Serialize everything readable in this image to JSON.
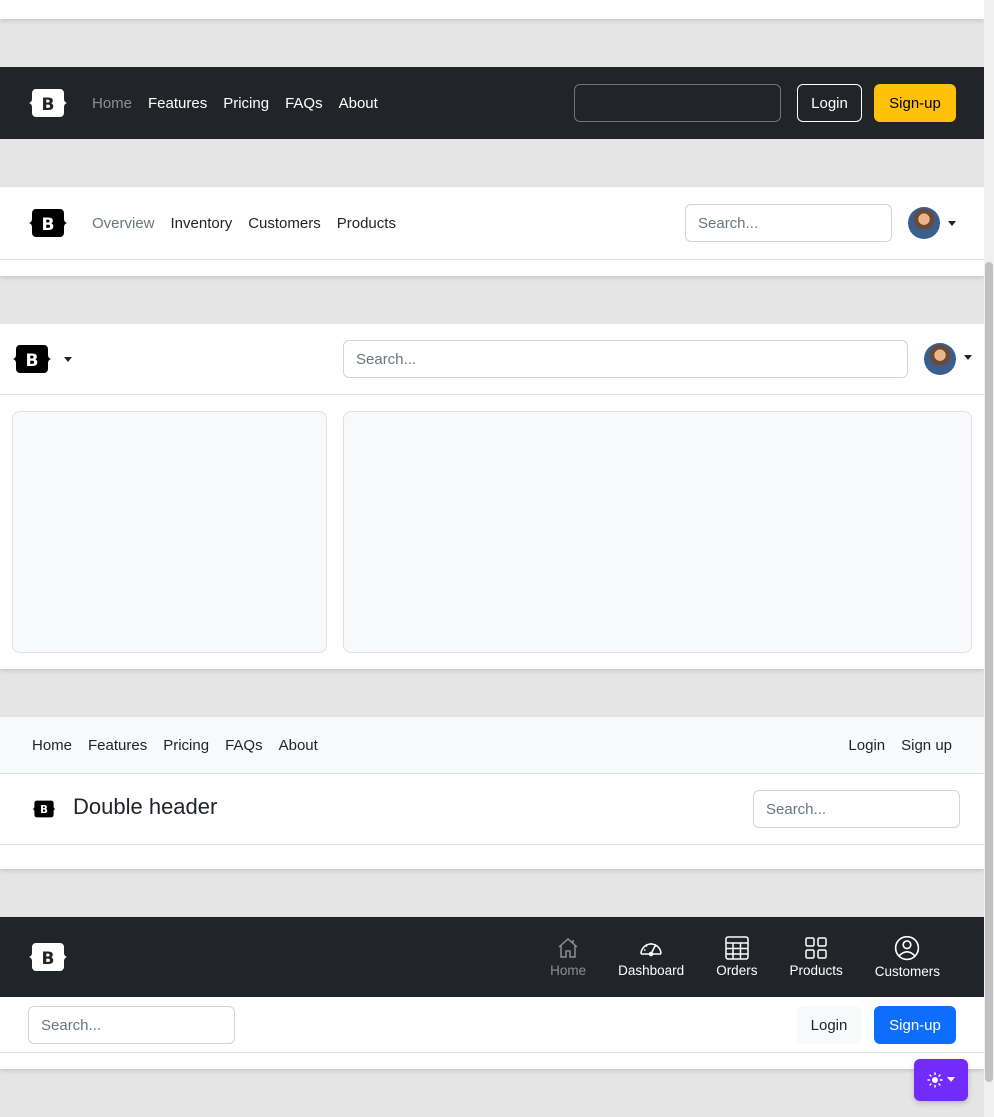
{
  "header1": {
    "nav": [
      "Home",
      "Features",
      "Pricing",
      "FAQs",
      "About"
    ],
    "search_value": "",
    "login_label": "Login",
    "signup_label": "Sign-up"
  },
  "header2": {
    "nav": [
      "Overview",
      "Inventory",
      "Customers",
      "Products"
    ],
    "search_placeholder": "Search..."
  },
  "header3": {
    "search_placeholder": "Search..."
  },
  "header4": {
    "nav": [
      "Home",
      "Features",
      "Pricing",
      "FAQs",
      "About"
    ],
    "login_label": "Login",
    "signup_label": "Sign up",
    "brand_title": "Double header",
    "search_placeholder": "Search..."
  },
  "header5": {
    "nav": [
      {
        "label": "Home",
        "icon": "house-icon"
      },
      {
        "label": "Dashboard",
        "icon": "speedometer-icon"
      },
      {
        "label": "Orders",
        "icon": "table-icon"
      },
      {
        "label": "Products",
        "icon": "grid-icon"
      },
      {
        "label": "Customers",
        "icon": "person-circle-icon"
      }
    ],
    "search_placeholder": "Search...",
    "login_label": "Login",
    "signup_label": "Sign-up"
  },
  "colors": {
    "dark": "#212529",
    "warning": "#ffc107",
    "primary": "#0d6efd",
    "theme_toggle": "#712cf9"
  }
}
